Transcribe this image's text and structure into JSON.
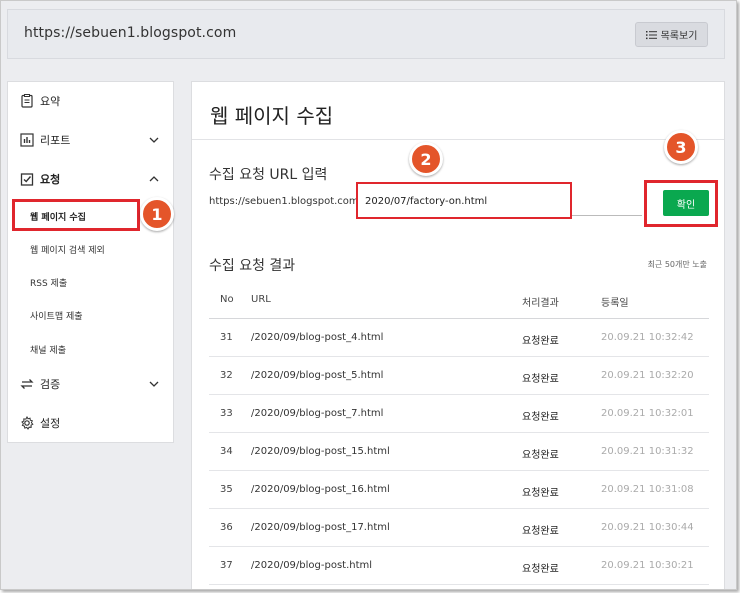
{
  "header": {
    "site_url": "https://sebuen1.blogspot.com",
    "list_button_label": "목록보기"
  },
  "sidebar": {
    "items": [
      {
        "label": "요약",
        "icon": "summary-icon"
      },
      {
        "label": "리포트",
        "icon": "report-icon"
      },
      {
        "label": "요청",
        "icon": "request-icon"
      },
      {
        "label": "검증",
        "icon": "verify-icon"
      },
      {
        "label": "설정",
        "icon": "gear-icon"
      }
    ],
    "sub_items": [
      {
        "label": "웹 페이지 수집"
      },
      {
        "label": "웹 페이지 검색 제외"
      },
      {
        "label": "RSS 제출"
      },
      {
        "label": "사이트맵 제출"
      },
      {
        "label": "채널 제출"
      }
    ]
  },
  "main": {
    "title": "웹 페이지 수집",
    "input_section_title": "수집 요청 URL 입력",
    "url_prefix": "https://sebuen1.blogspot.com/",
    "url_value": "2020/07/factory-on.html",
    "confirm_label": "확인",
    "results_title": "수집 요청 결과",
    "recent_note": "최근 50개만 노출",
    "table": {
      "headers": {
        "no": "No",
        "url": "URL",
        "status": "처리결과",
        "date": "등록일"
      },
      "rows": [
        {
          "no": "31",
          "url": "/2020/09/blog-post_4.html",
          "status": "요청완료",
          "date": "20.09.21 10:32:42"
        },
        {
          "no": "32",
          "url": "/2020/09/blog-post_5.html",
          "status": "요청완료",
          "date": "20.09.21 10:32:20"
        },
        {
          "no": "33",
          "url": "/2020/09/blog-post_7.html",
          "status": "요청완료",
          "date": "20.09.21 10:32:01"
        },
        {
          "no": "34",
          "url": "/2020/09/blog-post_15.html",
          "status": "요청완료",
          "date": "20.09.21 10:31:32"
        },
        {
          "no": "35",
          "url": "/2020/09/blog-post_16.html",
          "status": "요청완료",
          "date": "20.09.21 10:31:08"
        },
        {
          "no": "36",
          "url": "/2020/09/blog-post_17.html",
          "status": "요청완료",
          "date": "20.09.21 10:30:44"
        },
        {
          "no": "37",
          "url": "/2020/09/blog-post.html",
          "status": "요청완료",
          "date": "20.09.21 10:30:21"
        }
      ]
    }
  },
  "annotations": [
    {
      "number": "1"
    },
    {
      "number": "2"
    },
    {
      "number": "3"
    }
  ],
  "colors": {
    "accent_green": "#0aa84f",
    "highlight_red": "#e0262d",
    "badge_orange": "#e4552a"
  }
}
